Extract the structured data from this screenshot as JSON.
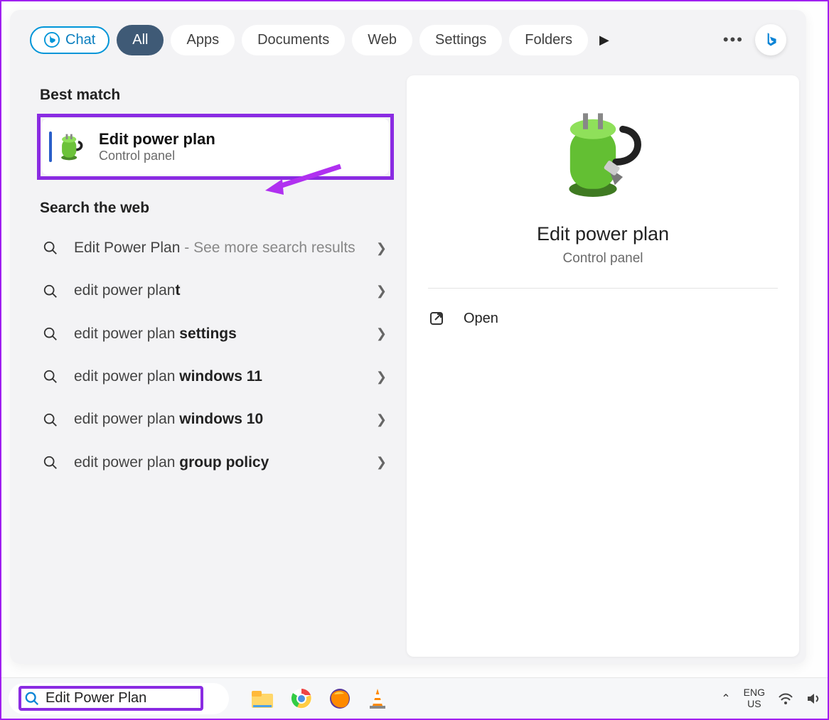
{
  "tabs": {
    "chat": "Chat",
    "items": [
      "All",
      "Apps",
      "Documents",
      "Web",
      "Settings",
      "Folders"
    ],
    "active_index": 0
  },
  "left": {
    "best_match_heading": "Best match",
    "best_match": {
      "title": "Edit power plan",
      "subtitle": "Control panel"
    },
    "search_web_heading": "Search the web",
    "web_items": [
      {
        "prefix": "Edit Power Plan",
        "suffix_muted": " - See more search results"
      },
      {
        "prefix": "edit power plan",
        "bold": "t"
      },
      {
        "prefix": "edit power plan ",
        "bold": "settings"
      },
      {
        "prefix": "edit power plan ",
        "bold": "windows 11"
      },
      {
        "prefix": "edit power plan ",
        "bold": "windows 10"
      },
      {
        "prefix": "edit power plan ",
        "bold": "group policy"
      }
    ]
  },
  "right": {
    "title": "Edit power plan",
    "subtitle": "Control panel",
    "open_label": "Open"
  },
  "taskbar": {
    "search_value": "Edit Power Plan",
    "lang_top": "ENG",
    "lang_bottom": "US"
  }
}
